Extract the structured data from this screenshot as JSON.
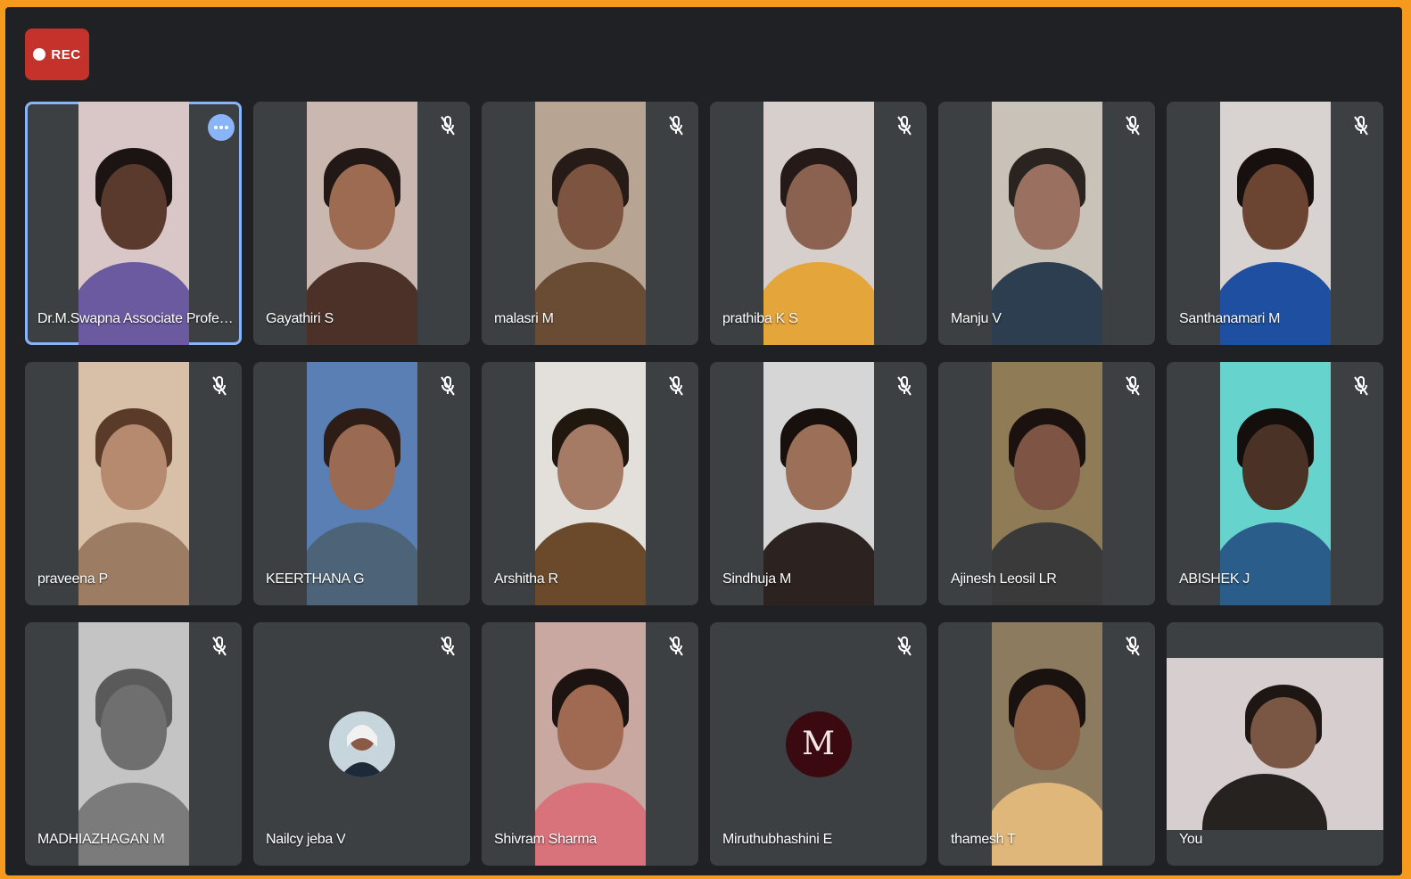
{
  "recording": {
    "label": "REC"
  },
  "participants": [
    {
      "name": "Dr.M.Swapna Associate Profes...",
      "active": true,
      "muted": false,
      "bg": "#d9c7c8",
      "skin": "#5b3a2e",
      "hair": "#1c1412",
      "shirt": "#6b5aa0"
    },
    {
      "name": "Gayathiri S",
      "muted": true,
      "bg": "#c9b7b0",
      "skin": "#9c6b52",
      "hair": "#221815",
      "shirt": "#4b3128"
    },
    {
      "name": "malasri M",
      "muted": true,
      "bg": "#b8a492",
      "skin": "#7d5440",
      "hair": "#261b16",
      "shirt": "#6a4c35"
    },
    {
      "name": "prathiba K S",
      "muted": true,
      "bg": "#d7cfcc",
      "skin": "#8b6150",
      "hair": "#251a17",
      "shirt": "#e4a53a"
    },
    {
      "name": "Manju V",
      "muted": true,
      "bg": "#c9c2b8",
      "skin": "#9a7160",
      "hair": "#2a2420",
      "shirt": "#2c3e4f"
    },
    {
      "name": "Santhanamari M",
      "muted": true,
      "bg": "#d8d2d0",
      "skin": "#6c4432",
      "hair": "#17100e",
      "shirt": "#1f4fa0"
    },
    {
      "name": "praveena P",
      "muted": true,
      "bg": "#d8c0a8",
      "skin": "#b68a6e",
      "hair": "#5a3b2a",
      "shirt": "#9c7c62"
    },
    {
      "name": "KEERTHANA G",
      "muted": true,
      "bg": "#5a7fb4",
      "skin": "#9a6a52",
      "hair": "#2d1d16",
      "shirt": "#4d6478"
    },
    {
      "name": "Arshitha R",
      "muted": true,
      "bg": "#e3e0dc",
      "skin": "#a57b65",
      "hair": "#20170f",
      "shirt": "#6a4a2a"
    },
    {
      "name": "Sindhuja M",
      "muted": true,
      "bg": "#d6d6d6",
      "skin": "#9c7058",
      "hair": "#18100d",
      "shirt": "#2c2320"
    },
    {
      "name": "Ajinesh Leosil LR",
      "muted": true,
      "bg": "#8f7b55",
      "skin": "#7e5445",
      "hair": "#1b120f",
      "shirt": "#3a3a3a"
    },
    {
      "name": "ABISHEK J",
      "muted": true,
      "bg": "#67d3cd",
      "skin": "#4b3226",
      "hair": "#140e0c",
      "shirt": "#2a5d8a"
    },
    {
      "name": "MADHIAZHAGAN M",
      "muted": true,
      "bg": "#c4c4c4",
      "skin": "#6f6f6f",
      "hair": "#5a5a5a",
      "shirt": "#7b7b7b"
    },
    {
      "name": "Nailcy jeba V",
      "muted": true,
      "avatar": "photo"
    },
    {
      "name": "Shivram Sharma",
      "muted": true,
      "bg": "#c8a8a0",
      "skin": "#a06a52",
      "hair": "#1d1411",
      "shirt": "#d9737b"
    },
    {
      "name": "Miruthubhashini E",
      "muted": true,
      "avatar": "letter",
      "initial": "M"
    },
    {
      "name": "thamesh T",
      "muted": true,
      "bg": "#8c7b5f",
      "skin": "#8a5d45",
      "hair": "#1a120e",
      "shirt": "#e0b77a"
    },
    {
      "name": "You",
      "muted": false,
      "self": true,
      "bg": "#d7cfcf",
      "skin": "#7a5644",
      "hair": "#1e1613",
      "shirt": "#26221f"
    }
  ],
  "icons": {
    "mic_off": "mic-off-icon",
    "more": "more-options-icon"
  },
  "colors": {
    "accent": "#8ab4f8",
    "rec": "#c5312b",
    "tile": "#3c4043",
    "background": "#202124",
    "border": "#f59a1c"
  }
}
